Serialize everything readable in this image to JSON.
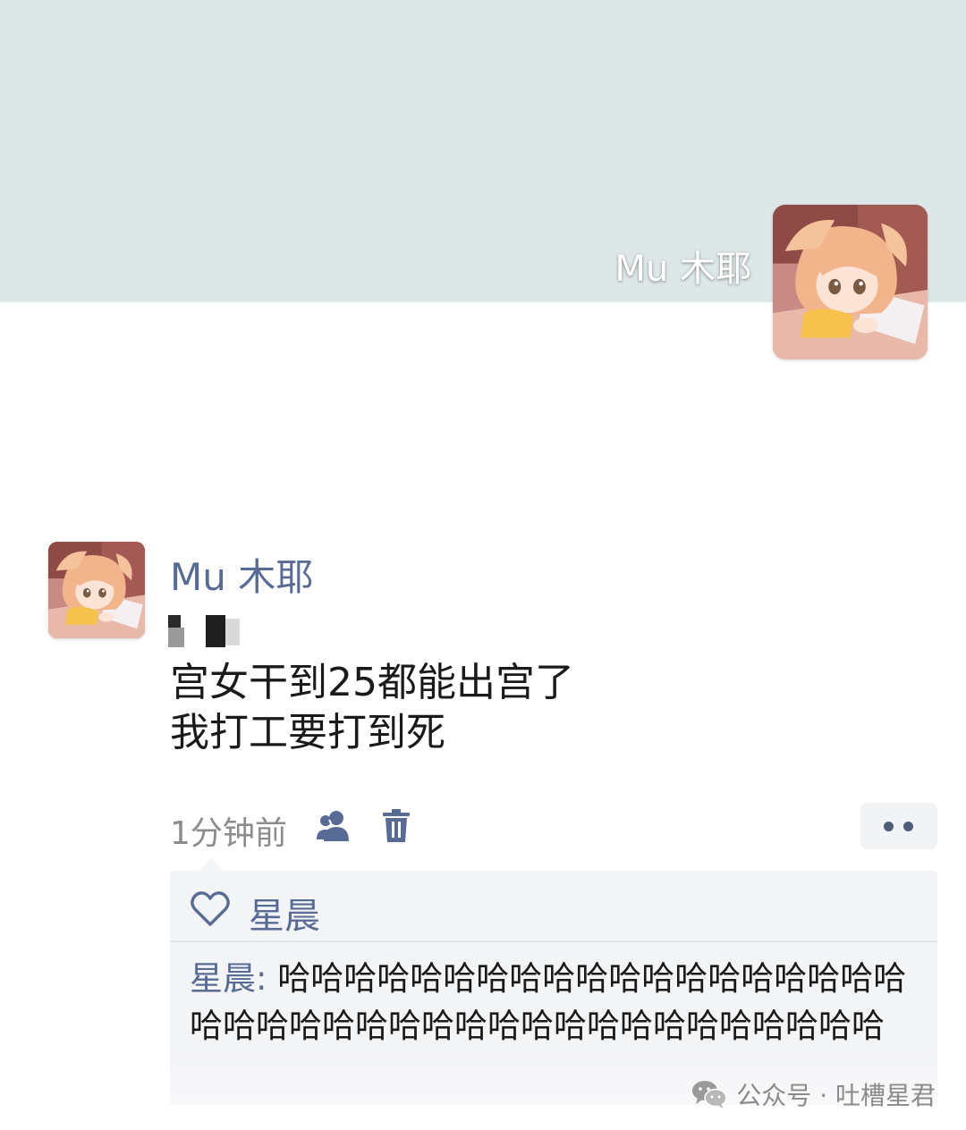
{
  "cover": {
    "user_name": "Mu 木耶",
    "background_color": "#dde7e7"
  },
  "post": {
    "author": "Mu 木耶",
    "text_lines": [
      "宫女干到25都能出宫了",
      "我打工要打到死"
    ],
    "time": "1分钟前",
    "icons": [
      "friends-icon",
      "trash-icon",
      "more-icon"
    ]
  },
  "likes": {
    "names": [
      "星晨"
    ],
    "icon": "heart-icon"
  },
  "comments": [
    {
      "author": "星晨",
      "separator": ": ",
      "text": "哈哈哈哈哈哈哈哈哈哈哈哈哈哈哈哈哈哈哈哈哈哈哈哈哈哈哈哈哈哈哈哈哈哈哈哈哈哈哈哈"
    }
  ],
  "watermark": {
    "text": "公众号 · 吐槽星君",
    "icon": "wechat-icon"
  },
  "colors": {
    "link_blue": "#576b95",
    "secondary_text": "#8c8c8c",
    "panel_bg": "#f3f4f6"
  }
}
